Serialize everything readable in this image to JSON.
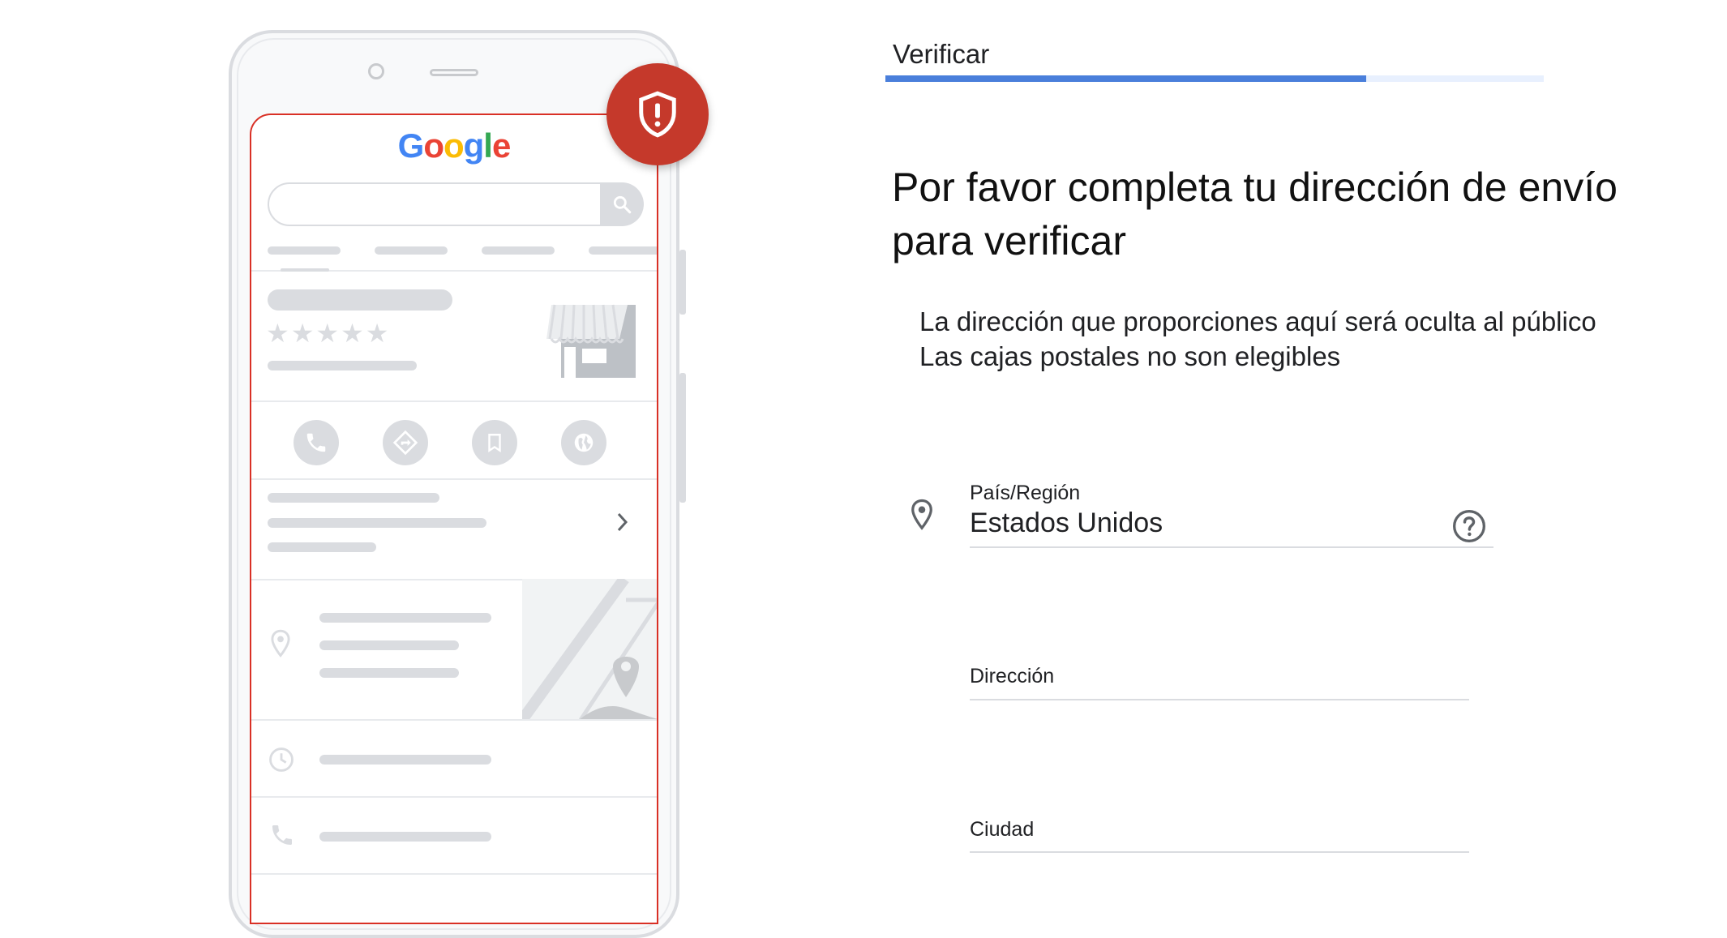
{
  "phone_mockup": {
    "logo_text": "Google",
    "logo_colors": [
      "#4285F4",
      "#EA4335",
      "#FBBC05",
      "#4285F4",
      "#34A853",
      "#EA4335"
    ],
    "rating_stars": "★★★★★",
    "action_icons": [
      "phone-icon",
      "directions-icon",
      "bookmark-icon",
      "globe-icon"
    ],
    "alert_badge_icon": "shield-alert-icon",
    "alert_color": "#c5392b"
  },
  "verify": {
    "step_title": "Verificar",
    "progress_fraction": 0.73,
    "accent_color": "#4a7fdb",
    "heading": "Por favor completa tu dirección de envío para verificar",
    "notes": [
      "La dirección que proporciones aquí será oculta al público",
      "Las cajas postales no son elegibles"
    ],
    "fields": {
      "country": {
        "label": "País/Región",
        "value": "Estados Unidos",
        "icon": "location-pin-icon",
        "help_icon": "help-circle-icon"
      },
      "address": {
        "label": "Dirección",
        "value": ""
      },
      "city": {
        "label": "Ciudad",
        "value": ""
      }
    }
  }
}
